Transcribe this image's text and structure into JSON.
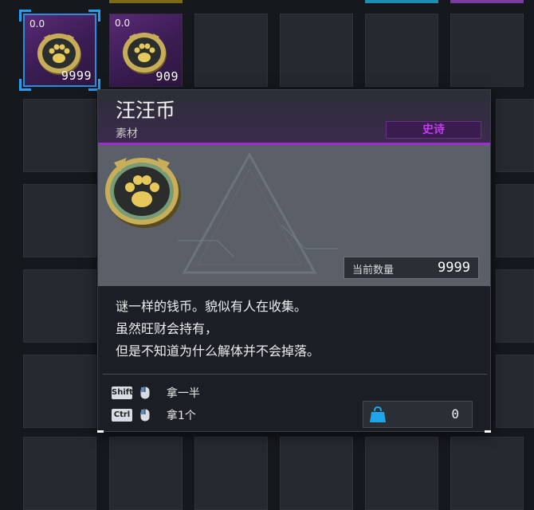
{
  "inventory": {
    "slots": [
      {
        "level": "0.0",
        "quantity": "9999",
        "icon": "paw-coin-icon",
        "selected": true
      },
      {
        "level": "0.0",
        "quantity": "909",
        "icon": "paw-coin-icon",
        "selected": false
      }
    ]
  },
  "tooltip": {
    "title": "汪汪币",
    "category": "素材",
    "rarity": "史诗",
    "current_count_label": "当前数量",
    "current_count_value": "9999",
    "description": [
      "谜一样的钱币。貌似有人在收集。",
      "虽然旺财会持有，",
      "但是不知道为什么解体并不会掉落。"
    ],
    "hints": [
      {
        "key": "Shift",
        "icon": "mouse-left-click-icon",
        "label": "拿一半"
      },
      {
        "key": "Ctrl",
        "icon": "mouse-left-click-icon",
        "label": "拿1个"
      }
    ],
    "weight_value": "0"
  },
  "colors": {
    "accent_select": "#2a9df0",
    "rarity_epic": "#c23cf0",
    "rarity_bar": "#9b2fd0"
  }
}
